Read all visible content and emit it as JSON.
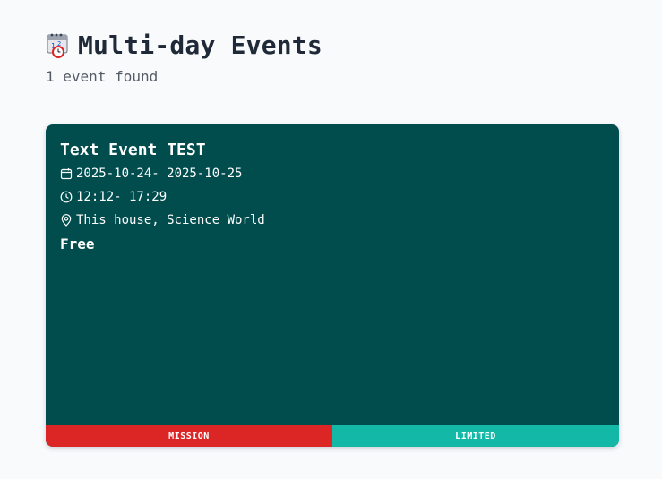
{
  "header": {
    "title_icon": "calendar-emoji-icon",
    "title": "Multi-day Events",
    "count_text": "1 event found"
  },
  "events": [
    {
      "title": "Text Event TEST",
      "date_range": "2025-10-24- 2025-10-25",
      "time_range": "12:12- 17:29",
      "location": "This house, Science World",
      "price": "Free",
      "tags": [
        {
          "label": "MISSION",
          "color": "#dc2626"
        },
        {
          "label": "LIMITED",
          "color": "#14b8a6"
        }
      ],
      "card_color": "#014d4e"
    }
  ],
  "colors": {
    "background": "#f8fafc",
    "title_text": "#1f2937",
    "subtitle_text": "#555b66"
  }
}
